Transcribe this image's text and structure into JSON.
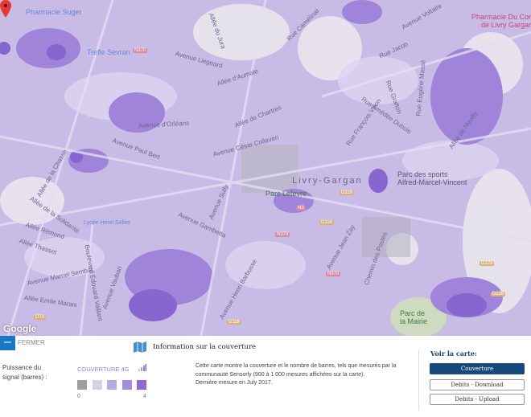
{
  "map": {
    "attribution": "Google",
    "city": "Livry-Gargan",
    "pois": {
      "pharmacie_suger": "Pharmacie Suger",
      "trefle_sevran": "Tréfle Sevran",
      "pharmacie_cora_1": "Pharmacie Du Cora",
      "pharmacie_cora_2": "de Livry Gargan",
      "parc_lefevre": "Parc Lefevre",
      "parc_sports_1": "Parc des sports",
      "parc_sports_2": "Alfred-Marcel-Vincent",
      "parc_mairie_1": "Parc de",
      "parc_mairie_2": "la Mairie",
      "lycee": "Lycée Henri Sellier"
    },
    "streets": [
      "Avenue Liegeard",
      "Allée d'Aumale",
      "Allée de Chartres",
      "Avenue César Collaveri",
      "Avenue d'Orléans",
      "Avenue Paul Bert",
      "Allée de la Chasse",
      "Allée de la Solidarité",
      "Allée Rémond",
      "Allée Thasset",
      "Avenue Marcel Sembat",
      "Allée Emile Marais",
      "Boulevard Édouard Vaillant",
      "Avenue Gambetta",
      "Avenue Sully",
      "Avenue Henri Barbusse",
      "Avenue Jean Zay",
      "Chemin des Postes",
      "Rue Jacob",
      "Rue Grafton",
      "Rue Eugène Massé",
      "Rue Amédée Dubois",
      "Rue François Villon",
      "Avenue Voltaire",
      "Rue Camélinat",
      "Allée du Jura",
      "Allée de Neuilly",
      "Avenue Vauban"
    ],
    "roads": {
      "n370": "N370",
      "d116": "D116",
      "n3": "N3",
      "d129": "D129",
      "d136": "D136",
      "d70": "D70"
    }
  },
  "panel": {
    "close_label": "FERMER",
    "signal_label": "Puissance du signal (barres) :",
    "coverage_label": "COUVERTURE 4G",
    "scale_min": "0",
    "scale_max": "4",
    "swatch_colors": [
      "#9e9e9e",
      "#d6d0ea",
      "#b9a9e2",
      "#a48ddc",
      "#8e6bd1"
    ],
    "info_title": "Information sur la couverture",
    "info_text_1": "Cette carte montre la couverture et le nombre de barres, tels que mesurés par la communauté Sensorly (900 à 1 000 mesures affichées sur la carte).",
    "info_text_2": "Dernière mesure en July 2017.",
    "view_label": "Voir la carte:",
    "buttons": [
      "Couverture",
      "Debits - Download",
      "Debits - Upload"
    ]
  }
}
